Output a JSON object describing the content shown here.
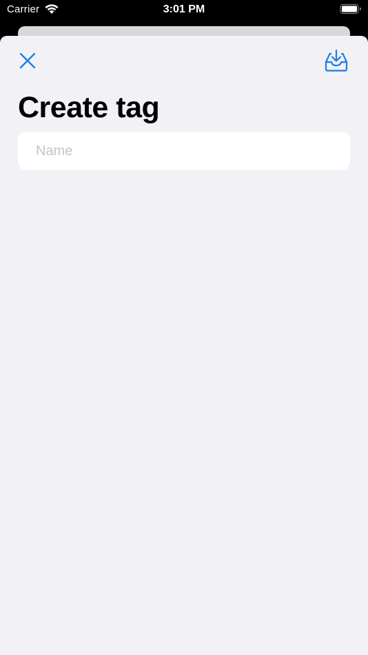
{
  "status_bar": {
    "carrier": "Carrier",
    "time": "3:01 PM",
    "wifi_icon": "wifi-icon",
    "battery_icon": "battery-icon"
  },
  "toolbar": {
    "close_icon": "close-icon",
    "save_icon": "tray-download-icon",
    "accent_color": "#1a7ee6"
  },
  "page": {
    "title": "Create tag"
  },
  "form": {
    "name_placeholder": "Name",
    "name_value": ""
  },
  "colors": {
    "sheet_background": "#f1f1f6",
    "field_background": "#ffffff",
    "placeholder": "#c4c4c7"
  }
}
